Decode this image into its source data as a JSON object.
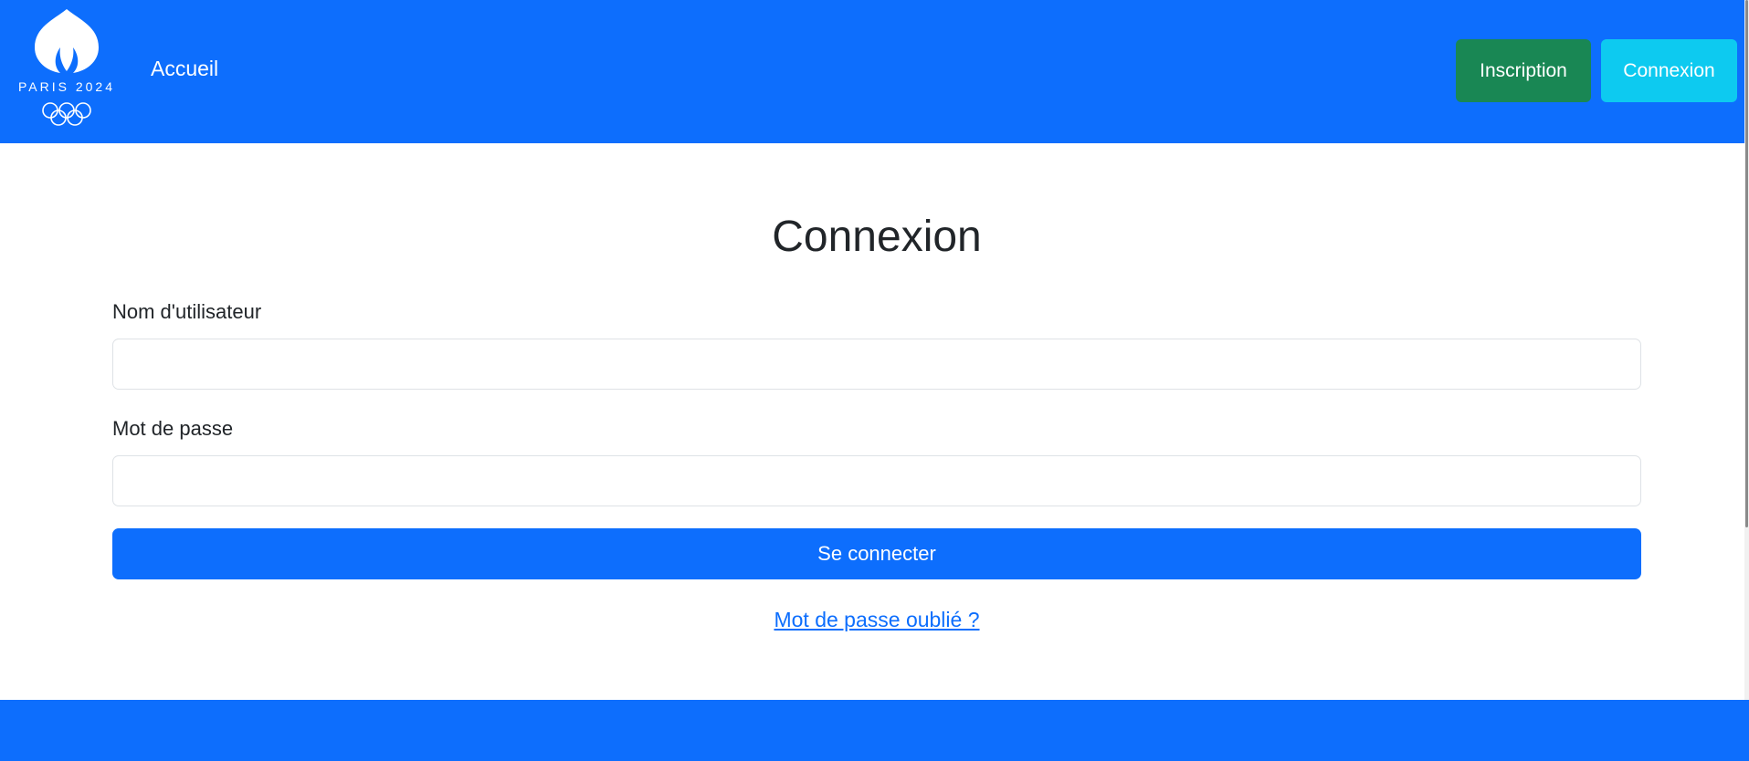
{
  "navbar": {
    "logo_text": "PARIS 2024",
    "home_link": "Accueil",
    "register_button": "Inscription",
    "login_button": "Connexion",
    "background_color": "#0d6efd"
  },
  "main": {
    "title": "Connexion",
    "username_label": "Nom d'utilisateur",
    "username_value": "",
    "password_label": "Mot de passe",
    "password_value": "",
    "submit_label": "Se connecter",
    "forgot_link": "Mot de passe oublié ?"
  },
  "colors": {
    "primary": "#0d6efd",
    "success": "#198754",
    "info": "#0dcaf0"
  }
}
